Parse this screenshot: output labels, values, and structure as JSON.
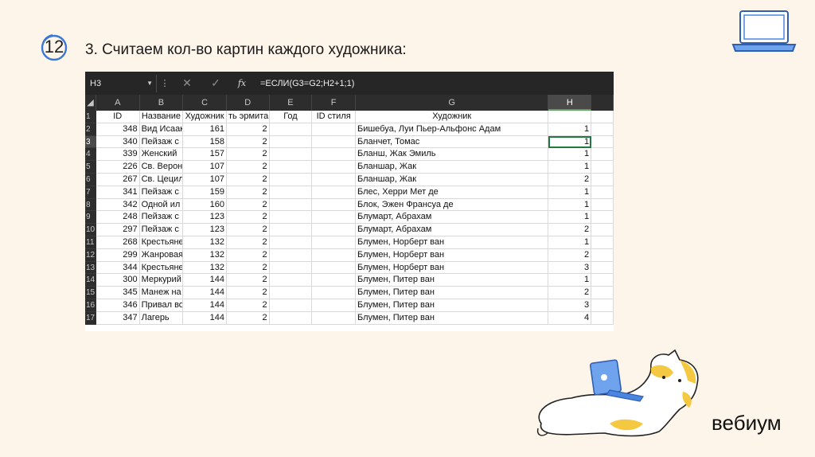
{
  "slide": {
    "number": "12",
    "title": "3. Считаем кол-во картин каждого художника:",
    "brand": "вебиум"
  },
  "formula_bar": {
    "name_box": "H3",
    "formula": "=ЕСЛИ(G3=G2;H2+1;1)"
  },
  "columns": [
    "A",
    "B",
    "C",
    "D",
    "E",
    "F",
    "G",
    "H"
  ],
  "selected_column": "H",
  "selected_row": "3",
  "header_row": {
    "row": "1",
    "cells": [
      "ID",
      "Название",
      "Художник",
      "ть эрмита",
      "Год",
      "ID стиля",
      "Художник",
      ""
    ]
  },
  "rows": [
    {
      "row": "2",
      "cells": [
        "348",
        "Вид Исаак",
        "161",
        "2",
        "",
        "",
        "Бишебуа, Луи Пьер-Альфонс Адам",
        "1"
      ]
    },
    {
      "row": "3",
      "cells": [
        "340",
        "Пейзаж с",
        "158",
        "2",
        "",
        "",
        "Бланчет, Томас",
        "1"
      ]
    },
    {
      "row": "4",
      "cells": [
        "339",
        "Женский",
        "157",
        "2",
        "",
        "",
        "Бланш, Жак Эмиль",
        "1"
      ]
    },
    {
      "row": "5",
      "cells": [
        "226",
        "Св. Верон",
        "107",
        "2",
        "",
        "",
        "Бланшар, Жак",
        "1"
      ]
    },
    {
      "row": "6",
      "cells": [
        "267",
        "Св. Цецил",
        "107",
        "2",
        "",
        "",
        "Бланшар, Жак",
        "2"
      ]
    },
    {
      "row": "7",
      "cells": [
        "341",
        "Пейзаж с",
        "159",
        "2",
        "",
        "",
        "Блес, Херри Мет де",
        "1"
      ]
    },
    {
      "row": "8",
      "cells": [
        "342",
        "Одной ил",
        "160",
        "2",
        "",
        "",
        "Блок, Эжен Франсуа де",
        "1"
      ]
    },
    {
      "row": "9",
      "cells": [
        "248",
        "Пейзаж с",
        "123",
        "2",
        "",
        "",
        "Блумарт, Абрахам",
        "1"
      ]
    },
    {
      "row": "10",
      "cells": [
        "297",
        "Пейзаж с",
        "123",
        "2",
        "",
        "",
        "Блумарт, Абрахам",
        "2"
      ]
    },
    {
      "row": "11",
      "cells": [
        "268",
        "Крестьяне",
        "132",
        "2",
        "",
        "",
        "Блумен, Норберт ван",
        "1"
      ]
    },
    {
      "row": "12",
      "cells": [
        "299",
        "Жанровая",
        "132",
        "2",
        "",
        "",
        "Блумен, Норберт ван",
        "2"
      ]
    },
    {
      "row": "13",
      "cells": [
        "344",
        "Крестьяне",
        "132",
        "2",
        "",
        "",
        "Блумен, Норберт ван",
        "3"
      ]
    },
    {
      "row": "14",
      "cells": [
        "300",
        "Меркурий",
        "144",
        "2",
        "",
        "",
        "Блумен, Питер ван",
        "1"
      ]
    },
    {
      "row": "15",
      "cells": [
        "345",
        "Манеж на",
        "144",
        "2",
        "",
        "",
        "Блумен, Питер ван",
        "2"
      ]
    },
    {
      "row": "16",
      "cells": [
        "346",
        "Привал во",
        "144",
        "2",
        "",
        "",
        "Блумен, Питер ван",
        "3"
      ]
    },
    {
      "row": "17",
      "cells": [
        "347",
        "Лагерь",
        "144",
        "2",
        "",
        "",
        "Блумен, Питер ван",
        "4"
      ]
    }
  ],
  "colors": {
    "background": "#fdf4ea",
    "accent_blue": "#3a78d6",
    "excel_dark": "#262626",
    "excel_select": "#1f7a40",
    "cat_yellow": "#f5c842"
  },
  "icons": {
    "laptop": "laptop-icon",
    "dropdown": "chevron-down-icon",
    "cancel": "x-icon",
    "confirm": "check-icon",
    "function": "fx-icon"
  }
}
